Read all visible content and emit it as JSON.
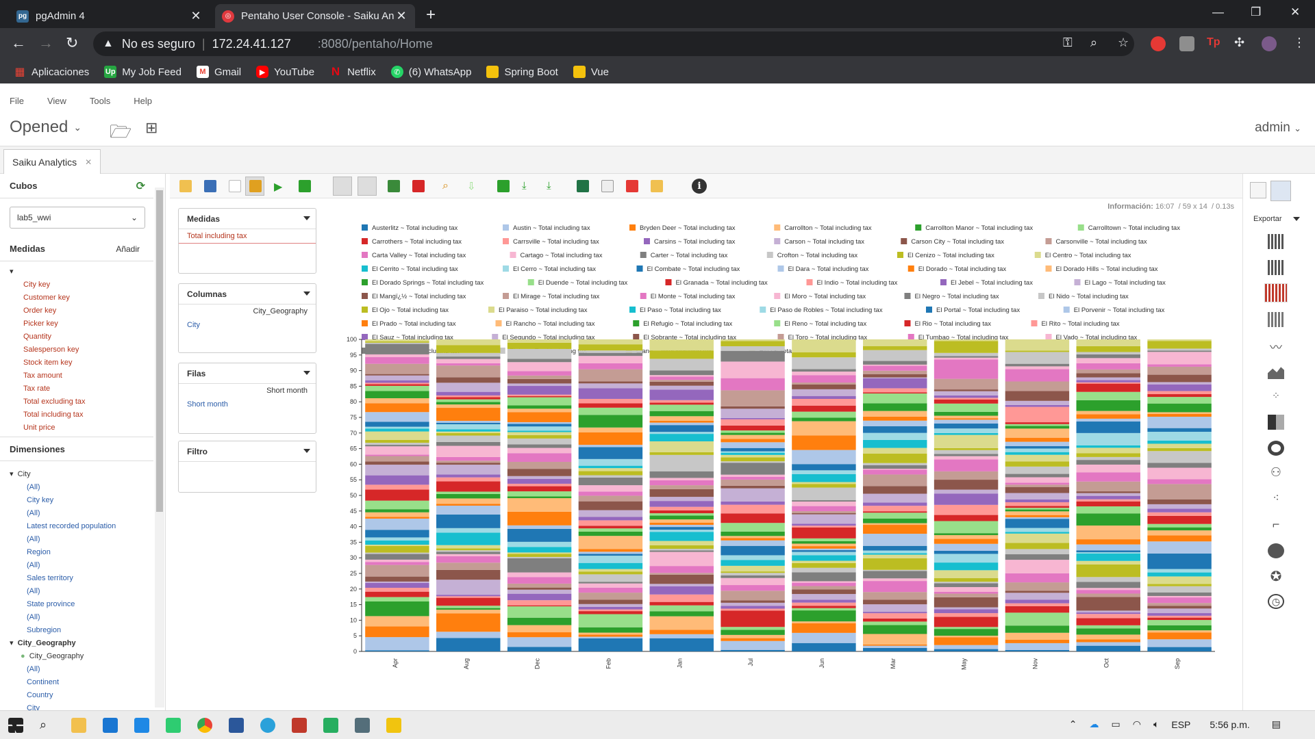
{
  "browser": {
    "tabs": [
      {
        "label": "pgAdmin 4",
        "icon": "pgadmin-icon"
      },
      {
        "label": "Pentaho User Console - Saiku An",
        "icon": "pentaho-icon"
      }
    ],
    "url": {
      "host": "172.24.41.127",
      "rest": ":8080/pentaho/Home",
      "security": "No es seguro"
    },
    "bookmarks": [
      {
        "label": "Aplicaciones",
        "color": "#e8eaed"
      },
      {
        "label": "My Job Feed",
        "color": "#26a642"
      },
      {
        "label": "Gmail",
        "color": "#ea4335"
      },
      {
        "label": "YouTube",
        "color": "#ff0000"
      },
      {
        "label": "Netflix",
        "color": "#e50914"
      },
      {
        "label": "(6) WhatsApp",
        "color": "#25d366"
      },
      {
        "label": "Spring Boot",
        "color": "#f4c20d"
      },
      {
        "label": "Vue",
        "color": "#f4c20d"
      }
    ]
  },
  "menu": {
    "file": "File",
    "view": "View",
    "tools": "Tools",
    "help": "Help"
  },
  "perspective": "Opened",
  "user": "admin",
  "saiku_tab": "Saiku Analytics",
  "left": {
    "cubes_title": "Cubos",
    "cube": "lab5_wwi",
    "measures_title": "Medidas",
    "add_label": "Añadir",
    "measures": [
      "City key",
      "Customer key",
      "Order key",
      "Picker key",
      "Quantity",
      "Salesperson key",
      "Stock item key",
      "Tax amount",
      "Tax rate",
      "Total excluding tax",
      "Total including tax",
      "Unit price"
    ],
    "dimensions_title": "Dimensiones",
    "dim_city": "City",
    "city_levels": [
      "(All)",
      "City key",
      "(All)",
      "Latest recorded population",
      "(All)",
      "Region",
      "(All)",
      "Sales territory",
      "(All)",
      "State province",
      "(All)",
      "Subregion"
    ],
    "dim_geo": "City_Geography",
    "geo_hier": "City_Geography",
    "geo_levels": [
      "(All)",
      "Continent",
      "Country",
      "City"
    ]
  },
  "zones": {
    "measures": {
      "title": "Medidas",
      "item": "Total including tax"
    },
    "columns": {
      "title": "Columnas",
      "hier": "City_Geography",
      "item": "City"
    },
    "rows": {
      "title": "Filas",
      "hier": "Short month",
      "item": "Short month"
    },
    "filter": {
      "title": "Filtro"
    }
  },
  "info": {
    "label": "Información:",
    "time": "16:07",
    "dims": "59 x 14",
    "secs": "0.13s"
  },
  "export_label": "Exportar",
  "taskbar": {
    "lang": "ESP",
    "time": "5:56 p.m."
  },
  "chart_data": {
    "type": "bar",
    "stacked": "100%",
    "categories": [
      "Apr",
      "Aug",
      "Dec",
      "Feb",
      "Jan",
      "Jul",
      "Jun",
      "Mar",
      "May",
      "Nov",
      "Oct",
      "Sep"
    ],
    "ylim": [
      0,
      100
    ],
    "yticks": [
      0,
      5,
      10,
      15,
      20,
      25,
      30,
      35,
      40,
      45,
      50,
      55,
      60,
      65,
      70,
      75,
      80,
      85,
      90,
      95,
      100
    ],
    "legend_position": "top",
    "series": [
      {
        "name": "Austerlitz ~ Total including tax",
        "color": "#1f77b4"
      },
      {
        "name": "Austin ~ Total including tax",
        "color": "#aec7e8"
      },
      {
        "name": "Bryden Deer ~ Total including tax",
        "color": "#ff7f0e"
      },
      {
        "name": "Carrollton ~ Total including tax",
        "color": "#ffbb78"
      },
      {
        "name": "Carrollton Manor ~ Total including tax",
        "color": "#2ca02c"
      },
      {
        "name": "Carrolltown ~ Total including tax",
        "color": "#98df8a"
      },
      {
        "name": "Carrothers ~ Total including tax",
        "color": "#d62728"
      },
      {
        "name": "Carrsville ~ Total including tax",
        "color": "#ff9896"
      },
      {
        "name": "Carsins ~ Total including tax",
        "color": "#9467bd"
      },
      {
        "name": "Carson ~ Total including tax",
        "color": "#c5b0d5"
      },
      {
        "name": "Carson City ~ Total including tax",
        "color": "#8c564b"
      },
      {
        "name": "Carsonville ~ Total including tax",
        "color": "#c49c94"
      },
      {
        "name": "Carta Valley ~ Total including tax",
        "color": "#e377c2"
      },
      {
        "name": "Cartago ~ Total including tax",
        "color": "#f7b6d2"
      },
      {
        "name": "Carter ~ Total including tax",
        "color": "#7f7f7f"
      },
      {
        "name": "Crofton ~ Total including tax",
        "color": "#c7c7c7"
      },
      {
        "name": "El Cenizo ~ Total including tax",
        "color": "#bcbd22"
      },
      {
        "name": "El Centro ~ Total including tax",
        "color": "#dbdb8d"
      },
      {
        "name": "El Cerrito ~ Total including tax",
        "color": "#17becf"
      },
      {
        "name": "El Cerro ~ Total including tax",
        "color": "#9edae5"
      },
      {
        "name": "El Combate ~ Total including tax",
        "color": "#1f77b4"
      },
      {
        "name": "El Dara ~ Total including tax",
        "color": "#aec7e8"
      },
      {
        "name": "El Dorado ~ Total including tax",
        "color": "#ff7f0e"
      },
      {
        "name": "El Dorado Hills ~ Total including tax",
        "color": "#ffbb78"
      },
      {
        "name": "El Dorado Springs ~ Total including tax",
        "color": "#2ca02c"
      },
      {
        "name": "El Duende ~ Total including tax",
        "color": "#98df8a"
      },
      {
        "name": "El Granada ~ Total including tax",
        "color": "#d62728"
      },
      {
        "name": "El Indio ~ Total including tax",
        "color": "#ff9896"
      },
      {
        "name": "El Jebel ~ Total including tax",
        "color": "#9467bd"
      },
      {
        "name": "El Lago ~ Total including tax",
        "color": "#c5b0d5"
      },
      {
        "name": "El Mangï¿½ ~ Total including tax",
        "color": "#8c564b"
      },
      {
        "name": "El Mirage ~ Total including tax",
        "color": "#c49c94"
      },
      {
        "name": "El Monte ~ Total including tax",
        "color": "#e377c2"
      },
      {
        "name": "El Moro ~ Total including tax",
        "color": "#f7b6d2"
      },
      {
        "name": "El Negro ~ Total including tax",
        "color": "#7f7f7f"
      },
      {
        "name": "El Nido ~ Total including tax",
        "color": "#c7c7c7"
      },
      {
        "name": "El Ojo ~ Total including tax",
        "color": "#bcbd22"
      },
      {
        "name": "El Paraiso ~ Total including tax",
        "color": "#dbdb8d"
      },
      {
        "name": "El Paso ~ Total including tax",
        "color": "#17becf"
      },
      {
        "name": "El Paso de Robles ~ Total including tax",
        "color": "#9edae5"
      },
      {
        "name": "El Portal ~ Total including tax",
        "color": "#1f77b4"
      },
      {
        "name": "El Porvenir ~ Total including tax",
        "color": "#aec7e8"
      },
      {
        "name": "El Prado ~ Total including tax",
        "color": "#ff7f0e"
      },
      {
        "name": "El Rancho ~ Total including tax",
        "color": "#ffbb78"
      },
      {
        "name": "El Refugio ~ Total including tax",
        "color": "#2ca02c"
      },
      {
        "name": "El Reno ~ Total including tax",
        "color": "#98df8a"
      },
      {
        "name": "El Rio ~ Total including tax",
        "color": "#d62728"
      },
      {
        "name": "El Rito ~ Total including tax",
        "color": "#ff9896"
      },
      {
        "name": "El Sauz ~ Total including tax",
        "color": "#9467bd"
      },
      {
        "name": "El Segundo ~ Total including tax",
        "color": "#c5b0d5"
      },
      {
        "name": "El Sobrante ~ Total including tax",
        "color": "#8c564b"
      },
      {
        "name": "El Toro ~ Total including tax",
        "color": "#c49c94"
      },
      {
        "name": "El Tumbao ~ Total including tax",
        "color": "#e377c2"
      },
      {
        "name": "El Vado ~ Total including tax",
        "color": "#f7b6d2"
      },
      {
        "name": "El Verano ~ Total including tax",
        "color": "#7f7f7f"
      },
      {
        "name": "Elaine ~ Total including tax",
        "color": "#c7c7c7"
      },
      {
        "name": "Eland ~ Total including tax",
        "color": "#bcbd22"
      },
      {
        "name": "Elba ~ Total including tax",
        "color": "#dbdb8d"
      }
    ]
  }
}
